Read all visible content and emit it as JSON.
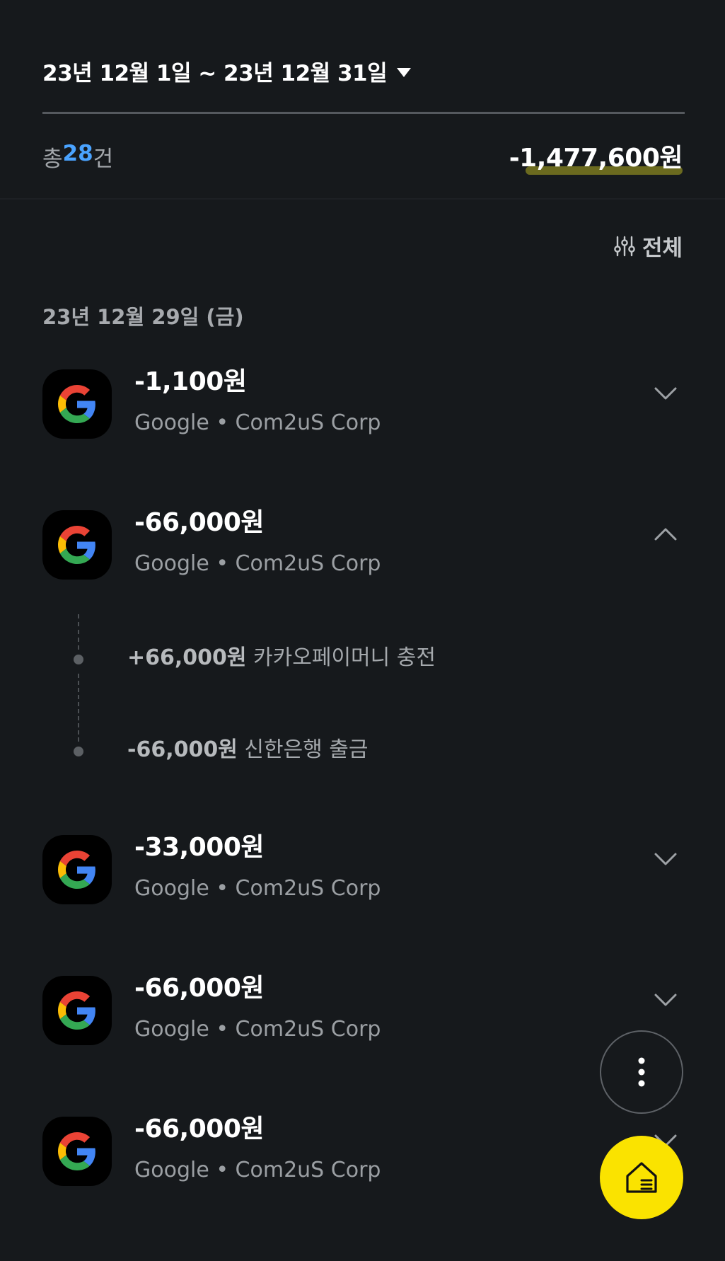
{
  "header": {
    "date_range": "23년 12월 1일 ~ 23년 12월 31일"
  },
  "summary": {
    "count_prefix": "총 ",
    "count_value": "28",
    "count_suffix": "건",
    "total": "-1,477,600원"
  },
  "filter": {
    "label": "전체"
  },
  "day": {
    "label": "23년 12월 29일 (금)"
  },
  "transactions": [
    {
      "amount": "-1,100원",
      "merchant": "Google • Com2uS Corp",
      "expanded": false
    },
    {
      "amount": "-66,000원",
      "merchant": "Google • Com2uS Corp",
      "expanded": true,
      "details": [
        {
          "amount": "+66,000원",
          "desc": " 카카오페이머니 충전"
        },
        {
          "amount": "-66,000원",
          "desc": " 신한은행 출금"
        }
      ]
    },
    {
      "amount": "-33,000원",
      "merchant": "Google • Com2uS Corp",
      "expanded": false
    },
    {
      "amount": "-66,000원",
      "merchant": "Google • Com2uS Corp",
      "expanded": false
    },
    {
      "amount": "-66,000원",
      "merchant": "Google • Com2uS Corp",
      "expanded": false
    }
  ],
  "icons": {
    "merchant": "google-logo-icon",
    "filter": "sliders-icon",
    "more": "more-vertical-icon",
    "home": "home-list-icon"
  },
  "colors": {
    "background": "#16191c",
    "accent_blue": "#4aa3ff",
    "fab_yellow": "#fae300",
    "total_underline": "#6b6a1f"
  }
}
